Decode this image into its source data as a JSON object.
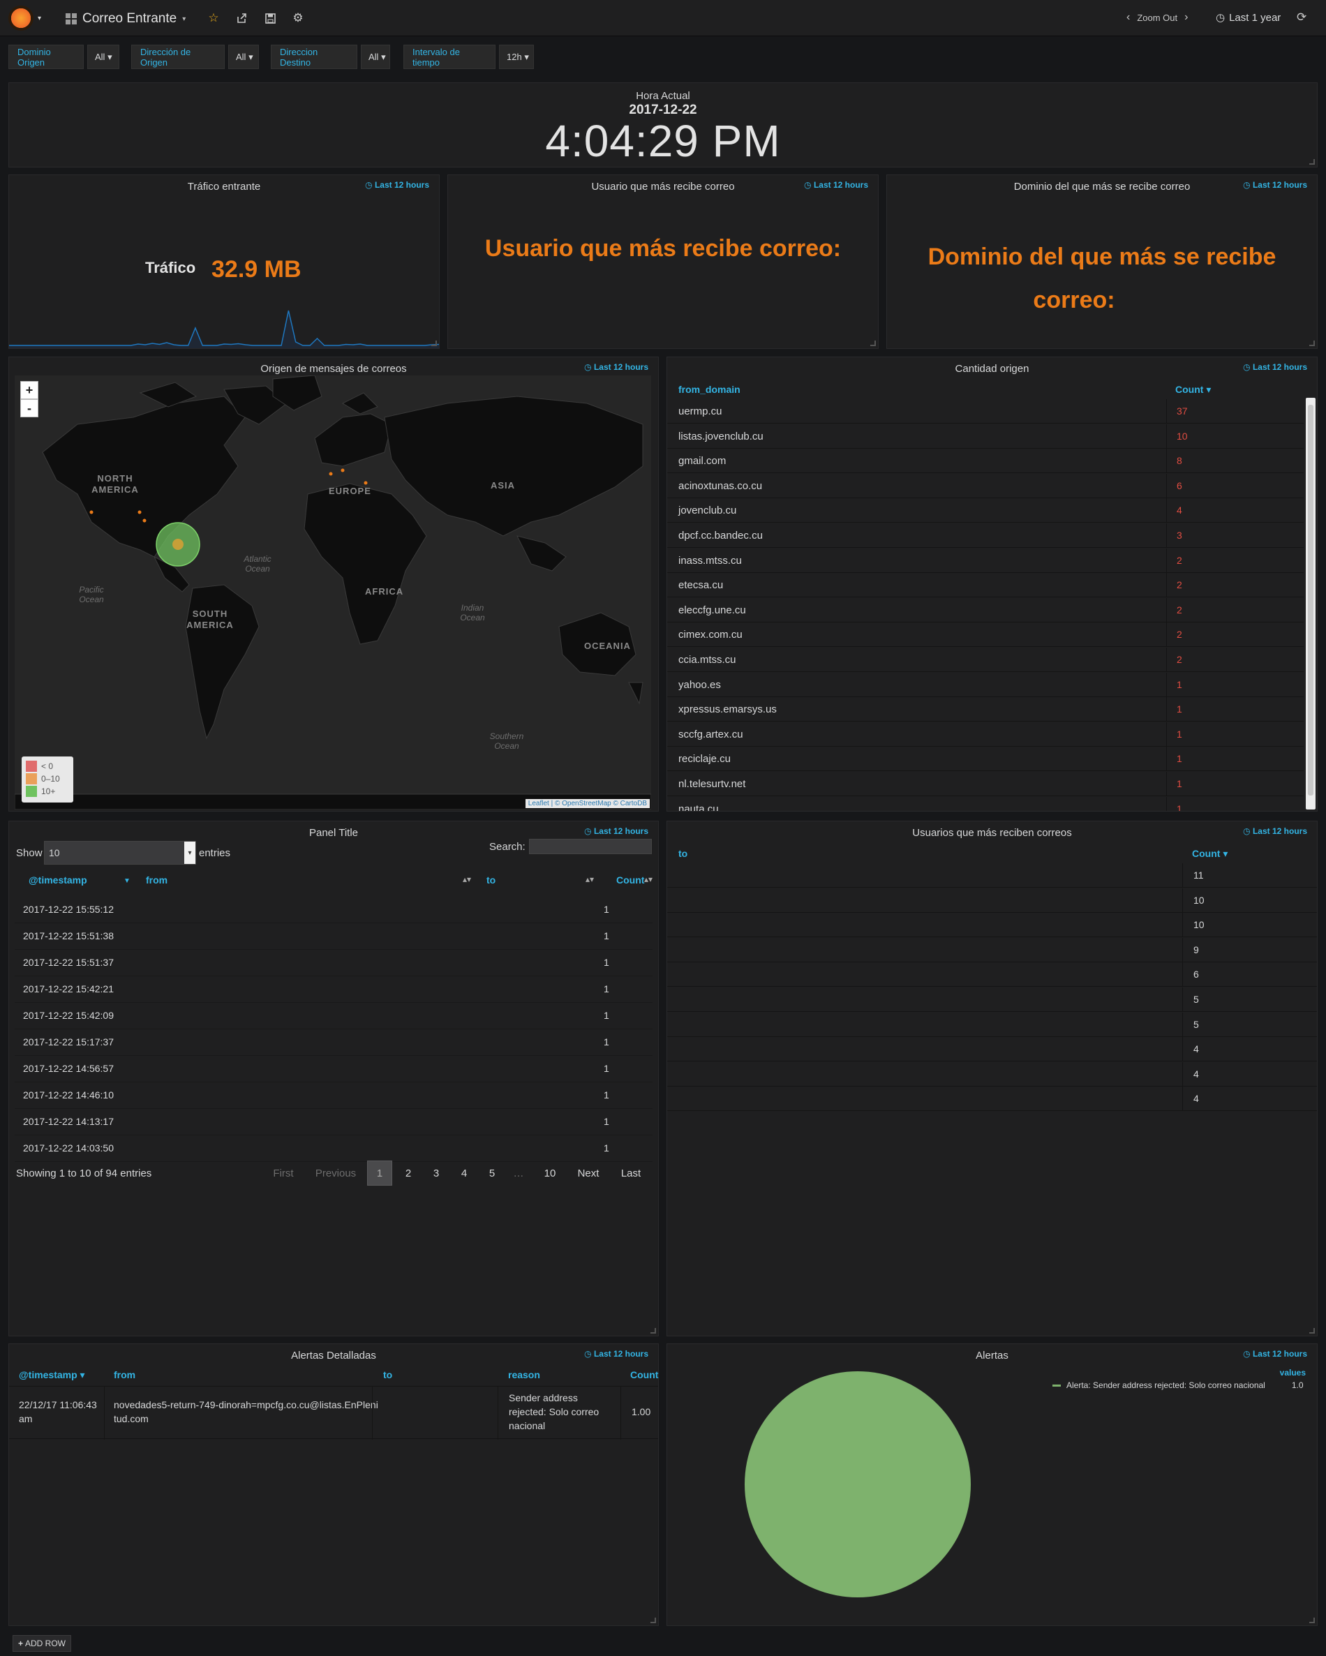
{
  "navbar": {
    "dashboard_title": "Correo Entrante",
    "zoom_out": "Zoom Out",
    "time_range": "Last 1 year"
  },
  "variables": [
    {
      "label": "Dominio Origen",
      "value": "All"
    },
    {
      "label": "Dirección de Origen",
      "value": "All"
    },
    {
      "label": "Direccion Destino",
      "value": "All"
    },
    {
      "label": "Intervalo de tiempo",
      "value": "12h"
    }
  ],
  "clock": {
    "label": "Hora Actual",
    "date": "2017-12-22",
    "time": "4:04:29 PM"
  },
  "traffic_panel": {
    "title": "Tráfico entrante",
    "time": "Last 12 hours",
    "prefix": "Tráfico",
    "value": "32.9 MB",
    "sparkline": [
      0,
      0,
      0,
      0,
      0,
      0,
      0,
      0,
      0,
      0,
      0,
      0,
      0,
      0,
      0,
      0,
      0,
      0,
      0.04,
      0.02,
      0.06,
      0.03,
      0.08,
      0.02,
      0,
      0,
      0.5,
      0,
      0,
      0,
      0.04,
      0.03,
      0.05,
      0.02,
      0,
      0,
      0,
      0,
      0,
      1,
      0.1,
      0,
      0,
      0.2,
      0,
      0,
      0,
      0.03,
      0.02,
      0.04,
      0,
      0,
      0,
      0,
      0,
      0,
      0,
      0,
      0,
      0.02,
      0.03
    ]
  },
  "user_panel": {
    "title": "Usuario que más recibe correo",
    "time": "Last 12 hours",
    "text": "Usuario que más recibe correo:"
  },
  "domain_panel": {
    "title": "Dominio del que más se recibe correo",
    "time": "Last 12 hours",
    "line1": "Dominio del que más se recibe",
    "line2": "correo:"
  },
  "map_panel": {
    "title": "Origen de mensajes de correos",
    "time": "Last 12 hours",
    "zoom_in": "+",
    "zoom_out": "-",
    "labels": {
      "north_america": "NORTH AMERICA",
      "europe": "EUROPE",
      "asia": "ASIA",
      "africa": "AFRICA",
      "south_america": "SOUTH AMERICA",
      "oceania": "OCEANIA",
      "atlantic": "Atlantic Ocean",
      "pacific": "Pacific Ocean",
      "indian": "Indian Ocean",
      "southern": "Southern Ocean"
    },
    "legend": [
      "< 0",
      "0–10",
      "10+"
    ],
    "legend_colors": [
      "#e06c6c",
      "#eaa05a",
      "#6fc25f"
    ],
    "attribution": "Leaflet | © OpenStreetMap © CartoDB"
  },
  "origin_table": {
    "title": "Cantidad origen",
    "time": "Last 12 hours",
    "col1": "from_domain",
    "col2": "Count ▾",
    "rows": [
      {
        "domain": "uermp.cu",
        "count": "37"
      },
      {
        "domain": "listas.jovenclub.cu",
        "count": "10"
      },
      {
        "domain": "gmail.com",
        "count": "8"
      },
      {
        "domain": "acinoxtunas.co.cu",
        "count": "6"
      },
      {
        "domain": "jovenclub.cu",
        "count": "4"
      },
      {
        "domain": "dpcf.cc.bandec.cu",
        "count": "3"
      },
      {
        "domain": "inass.mtss.cu",
        "count": "2"
      },
      {
        "domain": "etecsa.cu",
        "count": "2"
      },
      {
        "domain": "eleccfg.une.cu",
        "count": "2"
      },
      {
        "domain": "cimex.com.cu",
        "count": "2"
      },
      {
        "domain": "ccia.mtss.cu",
        "count": "2"
      },
      {
        "domain": "yahoo.es",
        "count": "1"
      },
      {
        "domain": "xpressus.emarsys.us",
        "count": "1"
      },
      {
        "domain": "sccfg.artex.cu",
        "count": "1"
      },
      {
        "domain": "reciclaje.cu",
        "count": "1"
      },
      {
        "domain": "nl.telesurtv.net",
        "count": "1"
      },
      {
        "domain": "nauta.cu",
        "count": "1"
      }
    ]
  },
  "log_table": {
    "title": "Panel Title",
    "time": "Last 12 hours",
    "show": "Show",
    "entries_value": "10",
    "entries": "entries",
    "search": "Search:",
    "headers": [
      "@timestamp",
      "from",
      "to",
      "Count"
    ],
    "rows": [
      {
        "ts": "2017-12-22 15:55:12",
        "count": "1"
      },
      {
        "ts": "2017-12-22 15:51:38",
        "count": "1"
      },
      {
        "ts": "2017-12-22 15:51:37",
        "count": "1"
      },
      {
        "ts": "2017-12-22 15:42:21",
        "count": "1"
      },
      {
        "ts": "2017-12-22 15:42:09",
        "count": "1"
      },
      {
        "ts": "2017-12-22 15:17:37",
        "count": "1"
      },
      {
        "ts": "2017-12-22 14:56:57",
        "count": "1"
      },
      {
        "ts": "2017-12-22 14:46:10",
        "count": "1"
      },
      {
        "ts": "2017-12-22 14:13:17",
        "count": "1"
      },
      {
        "ts": "2017-12-22 14:03:50",
        "count": "1"
      }
    ],
    "showing": "Showing 1 to 10 of 94 entries",
    "pagination": {
      "first": "First",
      "previous": "Previous",
      "pages": [
        "1",
        "2",
        "3",
        "4",
        "5",
        "…",
        "10"
      ],
      "next": "Next",
      "last": "Last"
    }
  },
  "users_table": {
    "title": "Usuarios que más reciben correos",
    "time": "Last 12 hours",
    "col1": "to",
    "col2": "Count ▾",
    "counts": [
      "11",
      "10",
      "10",
      "9",
      "6",
      "5",
      "5",
      "4",
      "4",
      "4"
    ]
  },
  "alerts_table": {
    "title": "Alertas Detalladas",
    "time": "Last 12 hours",
    "headers": [
      "@timestamp ▾",
      "from",
      "to",
      "reason",
      "Count"
    ],
    "row": {
      "ts": "22/12/17 11:06:43 am",
      "from": "novedades5-return-749-dinorah=mpcfg.co.cu@listas.EnPlenitud.com",
      "reason": "Sender address rejected: Solo correo nacional",
      "count": "1.00"
    }
  },
  "alerts_pie": {
    "title": "Alertas",
    "time": "Last 12 hours",
    "legend_header": "values",
    "legend_label": "Alerta: Sender address rejected: Solo correo nacional",
    "legend_value": "1.0",
    "color": "#7eb26d"
  },
  "add_row": "ADD ROW"
}
